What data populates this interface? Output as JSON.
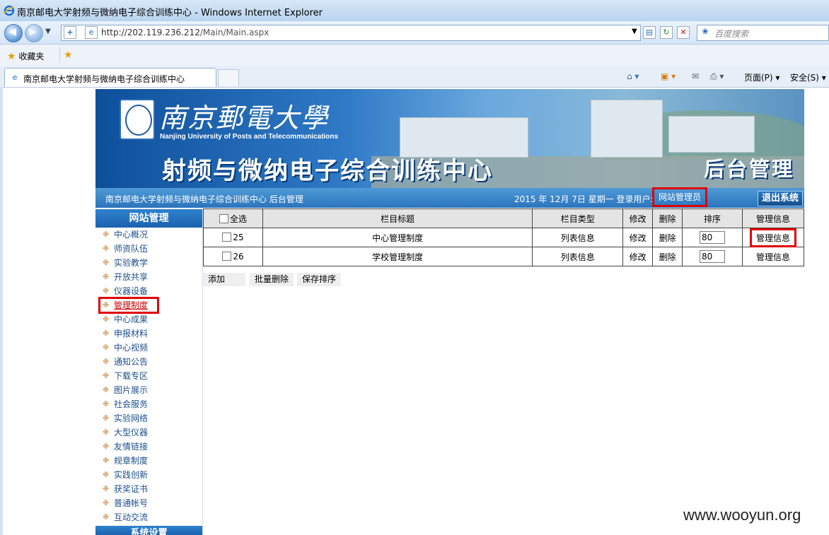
{
  "browser": {
    "window_title": "南京邮电大学射频与微纳电子综合训练中心 - Windows Internet Explorer",
    "url_host": "http://202.119.236.212",
    "url_path": "/Main/Main.aspx",
    "search_placeholder": "百度搜索",
    "favorites_label": "收藏夹",
    "tab_label": "南京邮电大学射频与微纳电子综合训练中心",
    "page_menu": "页面(P)",
    "safety_menu": "安全(S)"
  },
  "banner": {
    "university_cn": "南京郵電大學",
    "university_en": "Nanjing University of Posts and Telecommunications",
    "center_title": "射频与微纳电子综合训练中心",
    "admin_title": "后台管理"
  },
  "infobar": {
    "site_label": "南京邮电大学射频与微纳电子综合训练中心 后台管理",
    "date_label": "2015 年 12月 7日 星期一  登录用户:",
    "user": "网站管理员",
    "logout": "退出系统"
  },
  "sidebar": {
    "heading": "网站管理",
    "items": [
      {
        "label": "中心概况"
      },
      {
        "label": "师资队伍"
      },
      {
        "label": "实验教学"
      },
      {
        "label": "开放共享"
      },
      {
        "label": "仪器设备"
      },
      {
        "label": "管理制度"
      },
      {
        "label": "中心成果"
      },
      {
        "label": "申报材料"
      },
      {
        "label": "中心视频"
      },
      {
        "label": "通知公告"
      },
      {
        "label": "下载专区"
      },
      {
        "label": "图片展示"
      },
      {
        "label": "社会服务"
      },
      {
        "label": "实验网络"
      },
      {
        "label": "大型仪器"
      },
      {
        "label": "友情链接"
      },
      {
        "label": "规章制度"
      },
      {
        "label": "实践创新"
      },
      {
        "label": "获奖证书"
      },
      {
        "label": "普通帐号"
      },
      {
        "label": "互动交流"
      }
    ],
    "footer": "系统设置"
  },
  "table": {
    "headers": {
      "select_all": "全选",
      "title": "栏目标题",
      "type": "栏目类型",
      "edit": "修改",
      "delete": "删除",
      "sort": "排序",
      "manage": "管理信息"
    },
    "rows": [
      {
        "id": "25",
        "title": "中心管理制度",
        "type": "列表信息",
        "edit": "修改",
        "delete": "删除",
        "sort": "80",
        "manage": "管理信息"
      },
      {
        "id": "26",
        "title": "学校管理制度",
        "type": "列表信息",
        "edit": "修改",
        "delete": "删除",
        "sort": "80",
        "manage": "管理信息"
      }
    ]
  },
  "actions": {
    "add": "添加",
    "batch_delete": "批量删除",
    "save_sort": "保存排序"
  },
  "watermark": "www.wooyun.org"
}
